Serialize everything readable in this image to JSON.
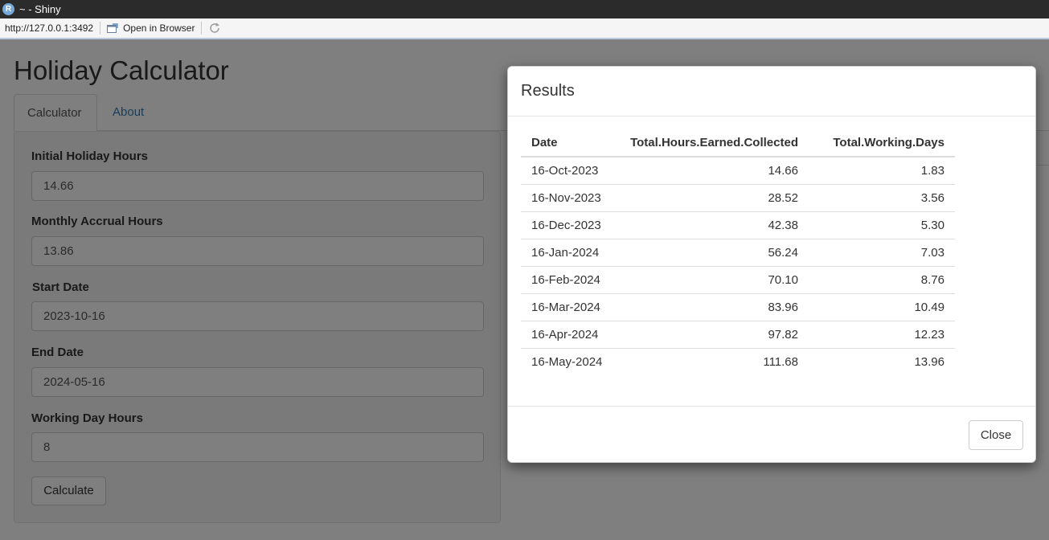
{
  "window": {
    "title": "~ - Shiny",
    "logo_letter": "R"
  },
  "toolbar": {
    "url": "http://127.0.0.1:3492",
    "open_in_browser": "Open in Browser"
  },
  "app": {
    "title": "Holiday Calculator",
    "tabs": [
      {
        "label": "Calculator",
        "active": true
      },
      {
        "label": "About",
        "active": false
      }
    ],
    "fields": [
      {
        "label": "Initial Holiday Hours",
        "value": "14.66"
      },
      {
        "label": "Monthly Accrual Hours",
        "value": "13.86"
      },
      {
        "label": "Start Date",
        "value": "2023-10-16"
      },
      {
        "label": "End Date",
        "value": "2024-05-16"
      },
      {
        "label": "Working Day Hours",
        "value": "8"
      }
    ],
    "calculate_label": "Calculate"
  },
  "modal": {
    "title": "Results",
    "columns": [
      "Date",
      "Total.Hours.Earned.Collected",
      "Total.Working.Days"
    ],
    "rows": [
      [
        "16-Oct-2023",
        "14.66",
        "1.83"
      ],
      [
        "16-Nov-2023",
        "28.52",
        "3.56"
      ],
      [
        "16-Dec-2023",
        "42.38",
        "5.30"
      ],
      [
        "16-Jan-2024",
        "56.24",
        "7.03"
      ],
      [
        "16-Feb-2024",
        "70.10",
        "8.76"
      ],
      [
        "16-Mar-2024",
        "83.96",
        "10.49"
      ],
      [
        "16-Apr-2024",
        "97.82",
        "12.23"
      ],
      [
        "16-May-2024",
        "111.68",
        "13.96"
      ]
    ],
    "close_label": "Close"
  },
  "colors": {
    "link": "#337ab7",
    "titlebar": "#2b2b2b",
    "backdrop": "rgba(0,0,0,0.5)"
  }
}
